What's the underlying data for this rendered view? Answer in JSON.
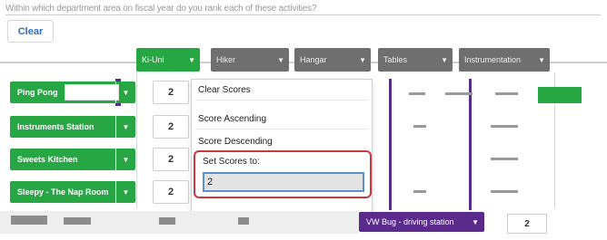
{
  "question": {
    "text": "Within which department area on fiscal year do you rank each of these activities?"
  },
  "toolbar": {
    "clear_label": "Clear"
  },
  "columns": [
    {
      "label": "Ki-Uni",
      "active": true
    },
    {
      "label": "Hiker",
      "active": false
    },
    {
      "label": "Hangar",
      "active": false
    },
    {
      "label": "Tables",
      "active": false
    },
    {
      "label": "Instrumentation",
      "active": false
    }
  ],
  "rows": [
    {
      "label": "Ping Pong",
      "score": "2"
    },
    {
      "label": "Instruments Station",
      "score": "2"
    },
    {
      "label": "Sweets Kitchen",
      "score": "2"
    },
    {
      "label": "Sleepy - The Nap Room",
      "score": "2"
    }
  ],
  "menu": {
    "clear_scores": "Clear Scores",
    "score_ascending": "Score Ascending",
    "score_descending": "Score Descending",
    "set_scores_label": "Set Scores to:",
    "set_scores_value": "2"
  },
  "bottom": {
    "bar_label": "VW Bug - driving station",
    "num_value": "2"
  },
  "colors": {
    "accent_green": "#27a644",
    "accent_purple": "#5a2a8c",
    "highlight_red": "#c9373f",
    "input_blue": "#5b8fd0"
  }
}
